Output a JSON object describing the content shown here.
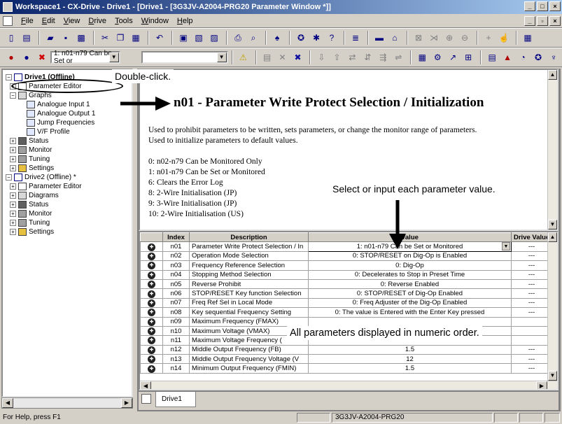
{
  "titlebar": {
    "title": "Workspace1 - CX-Drive - Drive1 - [Drive1 - [3G3JV-A2004-PRG20 Parameter Window *]]",
    "controls": [
      "_",
      "□",
      "×"
    ]
  },
  "menubar": {
    "items": [
      "File",
      "Edit",
      "View",
      "Drive",
      "Tools",
      "Window",
      "Help"
    ],
    "controls": [
      "_",
      "▫",
      "×"
    ]
  },
  "toolbar2": {
    "combo_value": "1: n01-n79 Can be Set or"
  },
  "tree": {
    "items": [
      {
        "label": "Drive1 (Offline)",
        "bold": true,
        "indent": 0
      },
      {
        "label": "Parameter Editor",
        "indent": 1
      },
      {
        "label": "Graphs",
        "indent": 1
      },
      {
        "label": "Analogue Input 1",
        "indent": 3
      },
      {
        "label": "Analogue Output 1",
        "indent": 3
      },
      {
        "label": "Jump Frequencies",
        "indent": 3
      },
      {
        "label": "V/F Profile",
        "indent": 3
      },
      {
        "label": "Status",
        "indent": 1
      },
      {
        "label": "Monitor",
        "indent": 1
      },
      {
        "label": "Tuning",
        "indent": 1
      },
      {
        "label": "Settings",
        "indent": 1
      },
      {
        "label": "Drive2 (Offline) *",
        "indent": 0
      },
      {
        "label": "Parameter Editor",
        "indent": 1
      },
      {
        "label": "Diagrams",
        "indent": 1
      },
      {
        "label": "Status",
        "indent": 1
      },
      {
        "label": "Monitor",
        "indent": 1
      },
      {
        "label": "Tuning",
        "indent": 1
      },
      {
        "label": "Settings",
        "indent": 1
      }
    ]
  },
  "doc": {
    "title": "n01 - Parameter Write Protect Selection / Initialization",
    "desc1": "Used to prohibit parameters to be written, sets parameters, or change the monitor range of parameters.",
    "desc2": "Used to initialize parameters to default values.",
    "options": [
      "0: n02-n79 Can be Monitored Only",
      "1: n01-n79 Can be Set or Monitored",
      "6: Clears the Error Log",
      "8: 2-Wire Initialisation (JP)",
      "9: 3-Wire Initialisation (JP)",
      "10: 2-Wire Initialisation (US)"
    ]
  },
  "grid": {
    "headers": [
      "",
      "Index",
      "Description",
      "Value",
      "Drive Value"
    ],
    "rows": [
      {
        "index": "n01",
        "description": "Parameter Write Protect Selection / In",
        "value": "1: n01-n79 Can be Set or Monitored",
        "drive": "---"
      },
      {
        "index": "n02",
        "description": "Operation Mode Selection",
        "value": "0: STOP/RESET on Dig-Op is Enabled",
        "drive": "---"
      },
      {
        "index": "n03",
        "description": "Frequency Reference Selection",
        "value": "0: Dig-Op",
        "drive": "---"
      },
      {
        "index": "n04",
        "description": "Stopping Method Selection",
        "value": "0: Decelerates to Stop in Preset Time",
        "drive": "---"
      },
      {
        "index": "n05",
        "description": "Reverse Prohibit",
        "value": "0: Reverse Enabled",
        "drive": "---"
      },
      {
        "index": "n06",
        "description": "STOP/RESET Key function Selection",
        "value": "0: STOP/RESET of Dig-Op Enabled",
        "drive": "---"
      },
      {
        "index": "n07",
        "description": "Freq Ref Sel in Local Mode",
        "value": "0: Freq Adjuster of the Dig-Op Enabled",
        "drive": "---"
      },
      {
        "index": "n08",
        "description": "Key sequential Frequency Setting",
        "value": "0: The value is Entered with the Enter Key pressed",
        "drive": "---"
      },
      {
        "index": "n09",
        "description": "Maximum Frequency (FMAX)",
        "value": "",
        "drive": ""
      },
      {
        "index": "n10",
        "description": "Maximum Voltage (VMAX)",
        "value": "",
        "drive": ""
      },
      {
        "index": "n11",
        "description": "Maximum Voltage Frequency (",
        "value": "",
        "drive": ""
      },
      {
        "index": "n12",
        "description": "Middle Output Frequency (FB)",
        "value": "1.5",
        "drive": "---"
      },
      {
        "index": "n13",
        "description": "Middle Output Frequency Voltage (V",
        "value": "12",
        "drive": "---"
      },
      {
        "index": "n14",
        "description": "Minimum Output Frequency (FMIN)",
        "value": "1.5",
        "drive": "---"
      }
    ]
  },
  "tabs": {
    "active": "Drive1"
  },
  "statusbar": {
    "help": "For Help, press F1",
    "model": "3G3JV-A2004-PRG20"
  },
  "callouts": {
    "double_click": "Double-click.",
    "select_input": "Select or input each parameter value.",
    "all_params": "All parameters displayed in numeric order."
  }
}
